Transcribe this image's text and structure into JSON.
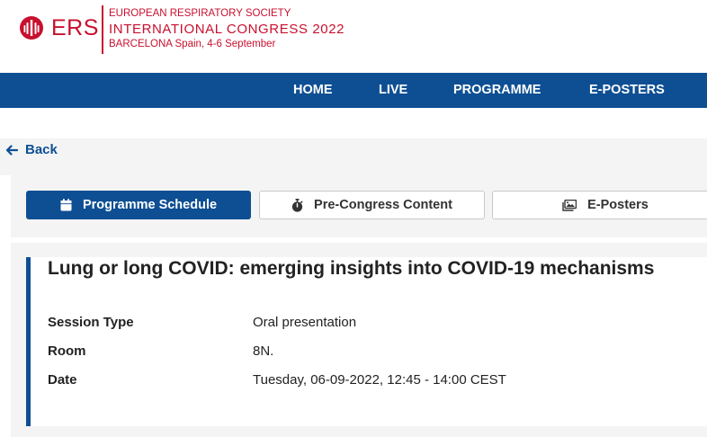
{
  "brand": {
    "acronym": "ERS",
    "society": "EUROPEAN RESPIRATORY SOCIETY",
    "congress": "INTERNATIONAL CONGRESS 2022",
    "location": "BARCELONA Spain, 4-6 September",
    "color": "#c8102e"
  },
  "nav": {
    "color": "#0e4f93",
    "items": [
      "HOME",
      "LIVE",
      "PROGRAMME",
      "E-POSTERS"
    ]
  },
  "back": {
    "label": "Back"
  },
  "tabs": [
    {
      "label": "Programme Schedule",
      "icon": "calendar-icon",
      "active": true
    },
    {
      "label": "Pre-Congress Content",
      "icon": "stopwatch-icon",
      "active": false
    },
    {
      "label": "E-Posters",
      "icon": "images-icon",
      "active": false
    }
  ],
  "session": {
    "title": "Lung or long COVID: emerging insights into COVID-19 mechanisms",
    "fields": [
      {
        "label": "Session Type",
        "value": "Oral presentation"
      },
      {
        "label": "Room",
        "value": "8N."
      },
      {
        "label": "Date",
        "value": "Tuesday, 06-09-2022, 12:45 - 14:00 CEST"
      }
    ]
  }
}
